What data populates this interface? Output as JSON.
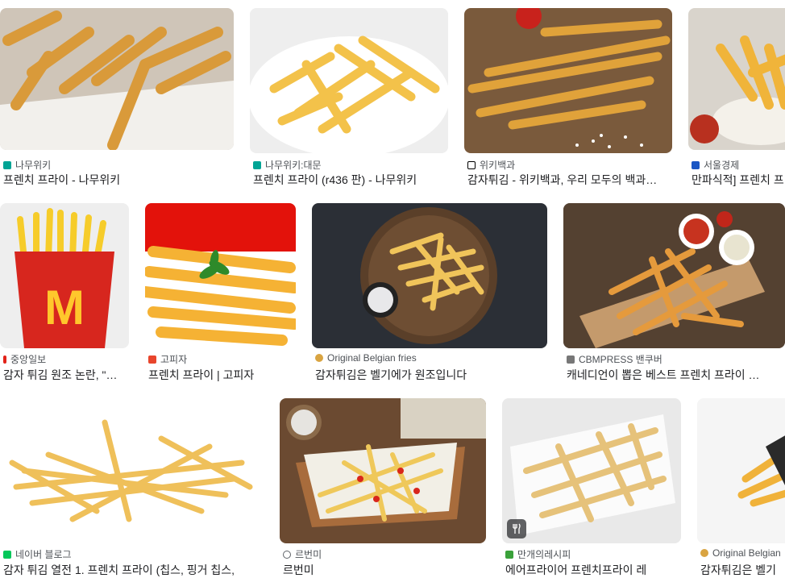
{
  "results": [
    {
      "source": "나무위키",
      "title": "프렌치 프라이 - 나무위키",
      "favicon": "namuwiki-icon",
      "fav_color": "#00a495"
    },
    {
      "source": "나무위키:대문",
      "title": "프렌치 프라이 (r436 판) - 나무위키",
      "favicon": "namuwiki-icon",
      "fav_color": "#00a495"
    },
    {
      "source": "위키백과",
      "title": "감자튀김 - 위키백과, 우리 모두의 백과…",
      "favicon": "wikipedia-icon",
      "fav_color": "#000000"
    },
    {
      "source": "서울경제",
      "title": "만파식적] 프렌치 프",
      "favicon": "seoul-economy-icon",
      "fav_color": "#1a56c4"
    },
    {
      "source": "중앙일보",
      "title": "감자 튀김 원조 논란, \"…",
      "favicon": "joongang-icon",
      "fav_color": "#e2231a"
    },
    {
      "source": "고피자",
      "title": "프렌치 프라이 | 고피자",
      "favicon": "gopizza-icon",
      "fav_color": "#e8452c"
    },
    {
      "source": "Original Belgian fries",
      "title": "감자튀김은 벨기에가 원조입니다",
      "favicon": "belgian-fries-icon",
      "fav_color": "#d9a441"
    },
    {
      "source": "CBMPRESS 밴쿠버",
      "title": "캐네디언이 뽑은 베스트 프렌치 프라이 …",
      "favicon": "cbmpress-icon",
      "fav_color": "#777777"
    },
    {
      "source": "네이버 블로그",
      "title": "감자 튀김 열전 1. 프렌치 프라이 (칩스, 핑거 칩스,",
      "favicon": "naver-blog-icon",
      "fav_color": "#03c75a"
    },
    {
      "source": "르번미",
      "title": "르번미",
      "favicon": "globe-icon",
      "fav_color": "#5f6368"
    },
    {
      "source": "만개의레시피",
      "title": "에어프라이어 프렌치프라이 레",
      "favicon": "10000recipe-icon",
      "fav_color": "#3aa13a"
    },
    {
      "source": "Original Belgian",
      "title": "감자튀김은 벨기",
      "favicon": "belgian-fries-icon",
      "fav_color": "#d9a441"
    }
  ],
  "badge_icon": "recipe-utensils-icon"
}
